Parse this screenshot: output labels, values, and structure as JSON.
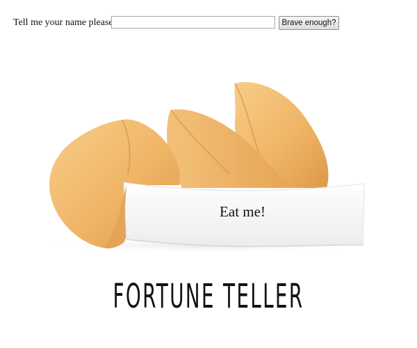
{
  "form": {
    "name_label": "Tell me your name please:",
    "name_value": "",
    "name_placeholder": "",
    "submit_label": "Brave enough?"
  },
  "fortune": {
    "message": "Eat me!"
  },
  "page": {
    "title": "FORTUNE TELLER"
  },
  "colors": {
    "cookie": "#f2b96a",
    "cookie_shadow": "#d99540",
    "paper": "#f7f7f7",
    "text": "#111111"
  }
}
